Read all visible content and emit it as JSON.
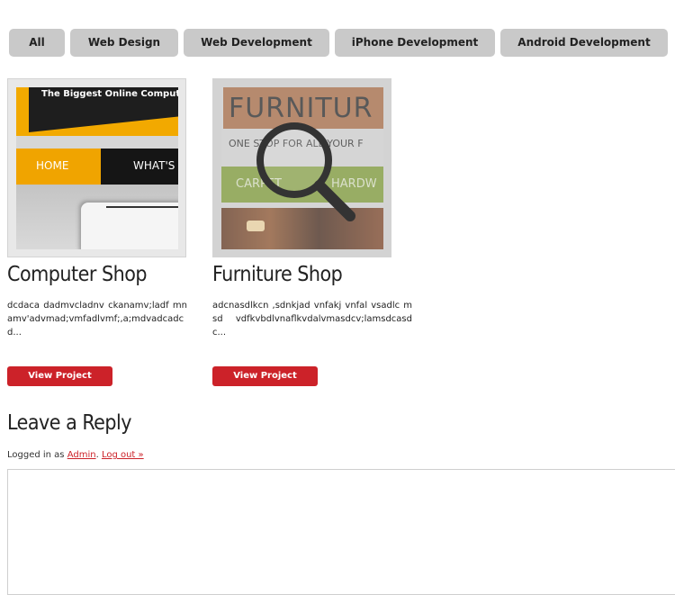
{
  "filters": [
    {
      "label": "All"
    },
    {
      "label": "Web Design"
    },
    {
      "label": "Web Development"
    },
    {
      "label": "iPhone Development"
    },
    {
      "label": "Android Development"
    }
  ],
  "projects": [
    {
      "title": "Computer Shop",
      "description": "dcdaca dadmvcladnv ckanamv;ladf mnamv'advmad;vmfadlvmf;,a;mdvadcadcd...",
      "button": "View Project",
      "thumb": {
        "banner": "The Biggest Online Compute",
        "nav1": "HOME",
        "nav2": "WHAT'S"
      }
    },
    {
      "title": "Furniture Shop",
      "description": "adcnasdlkcn ,sdnkjad vnfakj vnfal vsadlc msd vdfkvbdlvnaflkvdalvmasdcv;lamsdcasdc...",
      "button": "View Project",
      "thumb": {
        "logo": "FURNITUR",
        "tagline": "ONE STOP FOR ALL YOUR F",
        "nav1": "CARPET",
        "nav2": "HARDW"
      }
    }
  ],
  "reply": {
    "title": "Leave a Reply",
    "logged_prefix": "Logged in as ",
    "user": "Admin",
    "separator": ". ",
    "logout": "Log out »"
  },
  "colors": {
    "accent": "#cc2229",
    "filter_bg": "#c9c9c9"
  }
}
